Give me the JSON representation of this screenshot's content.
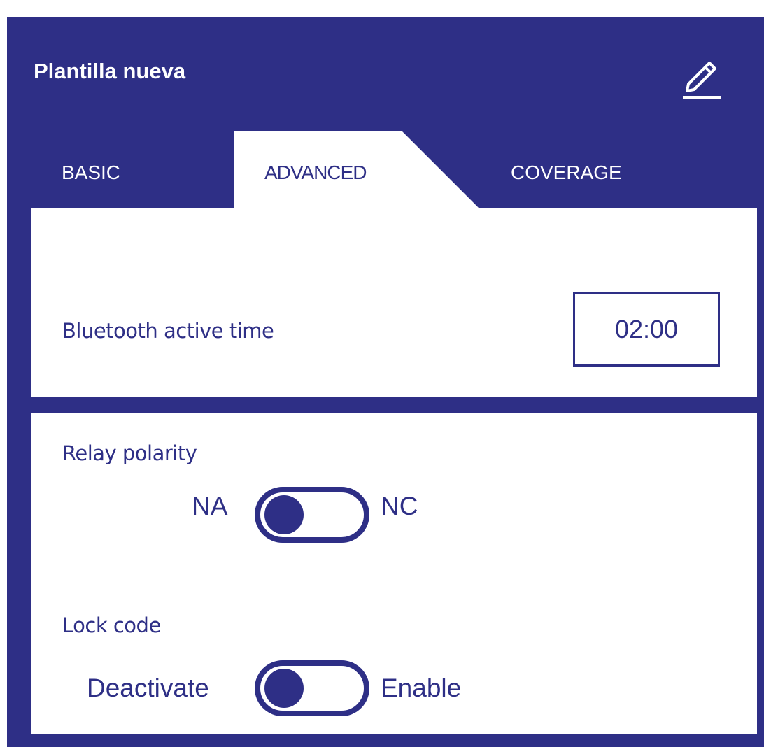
{
  "header": {
    "title": "Plantilla nueva",
    "edit_icon": "pencil-icon"
  },
  "tabs": [
    {
      "label": "BASIC",
      "active": false
    },
    {
      "label": "ADVANCED",
      "active": true
    },
    {
      "label": "COVERAGE",
      "active": false
    }
  ],
  "bluetooth": {
    "label": "Bluetooth active time",
    "value": "02:00"
  },
  "relay": {
    "label": "Relay polarity",
    "left_option": "NA",
    "right_option": "NC",
    "selected": "NA"
  },
  "lock": {
    "label": "Lock code",
    "left_option": "Deactivate",
    "right_option": "Enable",
    "selected": "Deactivate"
  },
  "colors": {
    "primary": "#2e2f86",
    "surface": "#ffffff"
  }
}
